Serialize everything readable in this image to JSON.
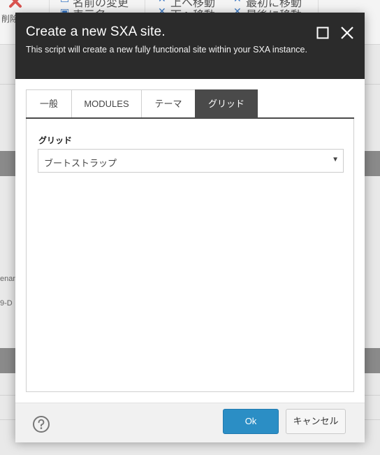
{
  "background": {
    "delete_label": "削除",
    "toolbar_items": [
      {
        "icon": "rename-icon",
        "label": "名前の変更"
      },
      {
        "icon": "edit-icon",
        "label": "表示名"
      },
      {
        "icon": "move-up-icon",
        "label": "上へ移動"
      },
      {
        "icon": "move-down-icon",
        "label": "下へ移動"
      },
      {
        "icon": "move-first-icon",
        "label": "最初に移動"
      },
      {
        "icon": "move-last-icon",
        "label": "最後に移動"
      }
    ],
    "side_text_1": "enan",
    "side_text_2": "9-D"
  },
  "dialog": {
    "title": "Create a new SXA site.",
    "subtitle": "This script will create a new fully functional site within your SXA instance.",
    "maximize_icon": "maximize-icon",
    "close_icon": "close-icon"
  },
  "tabs": [
    {
      "label": "一般",
      "active": false
    },
    {
      "label": "MODULES",
      "active": false
    },
    {
      "label": "テーマ",
      "active": false
    },
    {
      "label": "グリッド",
      "active": true
    }
  ],
  "grid_panel": {
    "label": "グリッド",
    "select_value": "ブートストラップ"
  },
  "footer": {
    "help_icon": "help-icon",
    "ok_label": "Ok",
    "cancel_label": "キャンセル"
  },
  "colors": {
    "header_bg": "#2b2b2b",
    "active_tab_bg": "#4a4a4a",
    "ok_button": "#2b8ec5",
    "delete_icon": "#d9534f"
  }
}
